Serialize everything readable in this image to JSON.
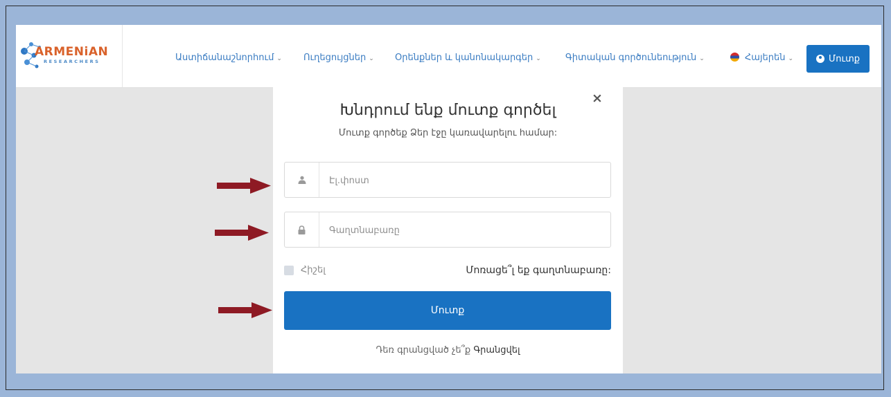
{
  "logo": {
    "word": "ARMENiAN",
    "sub": "RESEARCHERS"
  },
  "nav": {
    "items": [
      {
        "label": "Աստիճանաշնորհում"
      },
      {
        "label": "Ուղեցույցներ"
      },
      {
        "label": "Օրենքներ և կանոնակարգեր"
      },
      {
        "label": "Գիտական գործունեություն"
      }
    ],
    "language": "Հայերեն",
    "login_label": "Մուտք"
  },
  "modal": {
    "close": "×",
    "title": "Խնդրում ենք մուտք գործել",
    "subtitle": "Մուտք գործեք Ձեր էջը կառավարելու համար:",
    "email_placeholder": "Էլ.փոստ",
    "password_placeholder": "Գաղտնաբառը",
    "remember_label": "Հիշել",
    "forgot_label": "Մոռացե՞լ եք գաղտնաբառը:",
    "submit_label": "Մուտք",
    "register_prompt": "Դեռ գրանցված չե՞ք",
    "register_link": "Գրանցվել"
  },
  "colors": {
    "accent": "#1972c2",
    "arrow": "#8e1a24",
    "frame_bg": "#9bb5d8"
  }
}
